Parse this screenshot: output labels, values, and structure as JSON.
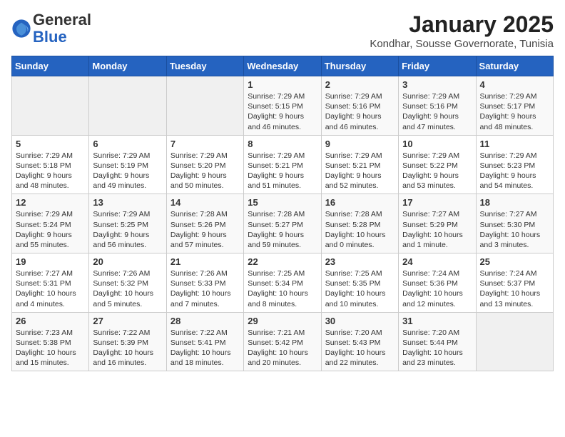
{
  "logo": {
    "general": "General",
    "blue": "Blue"
  },
  "title": "January 2025",
  "location": "Kondhar, Sousse Governorate, Tunisia",
  "weekdays": [
    "Sunday",
    "Monday",
    "Tuesday",
    "Wednesday",
    "Thursday",
    "Friday",
    "Saturday"
  ],
  "weeks": [
    [
      {
        "day": "",
        "content": ""
      },
      {
        "day": "",
        "content": ""
      },
      {
        "day": "",
        "content": ""
      },
      {
        "day": "1",
        "content": "Sunrise: 7:29 AM\nSunset: 5:15 PM\nDaylight: 9 hours and 46 minutes."
      },
      {
        "day": "2",
        "content": "Sunrise: 7:29 AM\nSunset: 5:16 PM\nDaylight: 9 hours and 46 minutes."
      },
      {
        "day": "3",
        "content": "Sunrise: 7:29 AM\nSunset: 5:16 PM\nDaylight: 9 hours and 47 minutes."
      },
      {
        "day": "4",
        "content": "Sunrise: 7:29 AM\nSunset: 5:17 PM\nDaylight: 9 hours and 48 minutes."
      }
    ],
    [
      {
        "day": "5",
        "content": "Sunrise: 7:29 AM\nSunset: 5:18 PM\nDaylight: 9 hours and 48 minutes."
      },
      {
        "day": "6",
        "content": "Sunrise: 7:29 AM\nSunset: 5:19 PM\nDaylight: 9 hours and 49 minutes."
      },
      {
        "day": "7",
        "content": "Sunrise: 7:29 AM\nSunset: 5:20 PM\nDaylight: 9 hours and 50 minutes."
      },
      {
        "day": "8",
        "content": "Sunrise: 7:29 AM\nSunset: 5:21 PM\nDaylight: 9 hours and 51 minutes."
      },
      {
        "day": "9",
        "content": "Sunrise: 7:29 AM\nSunset: 5:21 PM\nDaylight: 9 hours and 52 minutes."
      },
      {
        "day": "10",
        "content": "Sunrise: 7:29 AM\nSunset: 5:22 PM\nDaylight: 9 hours and 53 minutes."
      },
      {
        "day": "11",
        "content": "Sunrise: 7:29 AM\nSunset: 5:23 PM\nDaylight: 9 hours and 54 minutes."
      }
    ],
    [
      {
        "day": "12",
        "content": "Sunrise: 7:29 AM\nSunset: 5:24 PM\nDaylight: 9 hours and 55 minutes."
      },
      {
        "day": "13",
        "content": "Sunrise: 7:29 AM\nSunset: 5:25 PM\nDaylight: 9 hours and 56 minutes."
      },
      {
        "day": "14",
        "content": "Sunrise: 7:28 AM\nSunset: 5:26 PM\nDaylight: 9 hours and 57 minutes."
      },
      {
        "day": "15",
        "content": "Sunrise: 7:28 AM\nSunset: 5:27 PM\nDaylight: 9 hours and 59 minutes."
      },
      {
        "day": "16",
        "content": "Sunrise: 7:28 AM\nSunset: 5:28 PM\nDaylight: 10 hours and 0 minutes."
      },
      {
        "day": "17",
        "content": "Sunrise: 7:27 AM\nSunset: 5:29 PM\nDaylight: 10 hours and 1 minute."
      },
      {
        "day": "18",
        "content": "Sunrise: 7:27 AM\nSunset: 5:30 PM\nDaylight: 10 hours and 3 minutes."
      }
    ],
    [
      {
        "day": "19",
        "content": "Sunrise: 7:27 AM\nSunset: 5:31 PM\nDaylight: 10 hours and 4 minutes."
      },
      {
        "day": "20",
        "content": "Sunrise: 7:26 AM\nSunset: 5:32 PM\nDaylight: 10 hours and 5 minutes."
      },
      {
        "day": "21",
        "content": "Sunrise: 7:26 AM\nSunset: 5:33 PM\nDaylight: 10 hours and 7 minutes."
      },
      {
        "day": "22",
        "content": "Sunrise: 7:25 AM\nSunset: 5:34 PM\nDaylight: 10 hours and 8 minutes."
      },
      {
        "day": "23",
        "content": "Sunrise: 7:25 AM\nSunset: 5:35 PM\nDaylight: 10 hours and 10 minutes."
      },
      {
        "day": "24",
        "content": "Sunrise: 7:24 AM\nSunset: 5:36 PM\nDaylight: 10 hours and 12 minutes."
      },
      {
        "day": "25",
        "content": "Sunrise: 7:24 AM\nSunset: 5:37 PM\nDaylight: 10 hours and 13 minutes."
      }
    ],
    [
      {
        "day": "26",
        "content": "Sunrise: 7:23 AM\nSunset: 5:38 PM\nDaylight: 10 hours and 15 minutes."
      },
      {
        "day": "27",
        "content": "Sunrise: 7:22 AM\nSunset: 5:39 PM\nDaylight: 10 hours and 16 minutes."
      },
      {
        "day": "28",
        "content": "Sunrise: 7:22 AM\nSunset: 5:41 PM\nDaylight: 10 hours and 18 minutes."
      },
      {
        "day": "29",
        "content": "Sunrise: 7:21 AM\nSunset: 5:42 PM\nDaylight: 10 hours and 20 minutes."
      },
      {
        "day": "30",
        "content": "Sunrise: 7:20 AM\nSunset: 5:43 PM\nDaylight: 10 hours and 22 minutes."
      },
      {
        "day": "31",
        "content": "Sunrise: 7:20 AM\nSunset: 5:44 PM\nDaylight: 10 hours and 23 minutes."
      },
      {
        "day": "",
        "content": ""
      }
    ]
  ]
}
